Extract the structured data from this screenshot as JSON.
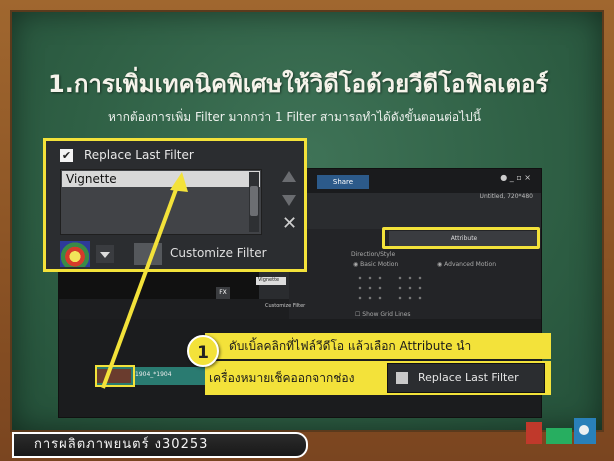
{
  "slide": {
    "title": "1.การเพิ่มเทคนิคพิเศษให้วิดีโอด้วยวีดีโอฟิลเตอร์",
    "subtitle": "หากต้องการเพิ่ม Filter มากกว่า 1 Filter สามารถทำได้ดังขั้นตอนต่อไปนี้"
  },
  "app": {
    "tab_share": "Share",
    "untitled": "Untitled, 720*480",
    "window_controls": "● _ ▫ ×",
    "attribute_label": "Attribute",
    "direction_style": "Direction/Style",
    "basic_motion": "◉ Basic Motion",
    "advanced_motion": "◉ Advanced Motion",
    "distort_lines": "☐ Show Grid Lines",
    "fx_label": "FX",
    "mini_filter": "Vignette",
    "mini_customize": "Customize Filter",
    "clip_label": "1904_*1904"
  },
  "zoom_panel": {
    "replace_checked": "✔",
    "replace_label": "Replace Last Filter",
    "filter_item": "Vignette",
    "delete_icon": "✕",
    "customize_label": "Customize Filter"
  },
  "instruction": {
    "step_number": "1",
    "line1": "ดับเบิ้ลคลิกที่ไฟล์วีดีโอ แล้วเลือก Attribute นำ",
    "line2": "เครื่องหมายเช็คออกจากช่อง",
    "checkbox_label": "Replace Last Filter"
  },
  "footer": {
    "course": "การผลิตภาพยนตร์ ง30253"
  },
  "colors": {
    "highlight": "#f3e23a",
    "board": "#2f6045",
    "frame": "#8a5224"
  }
}
